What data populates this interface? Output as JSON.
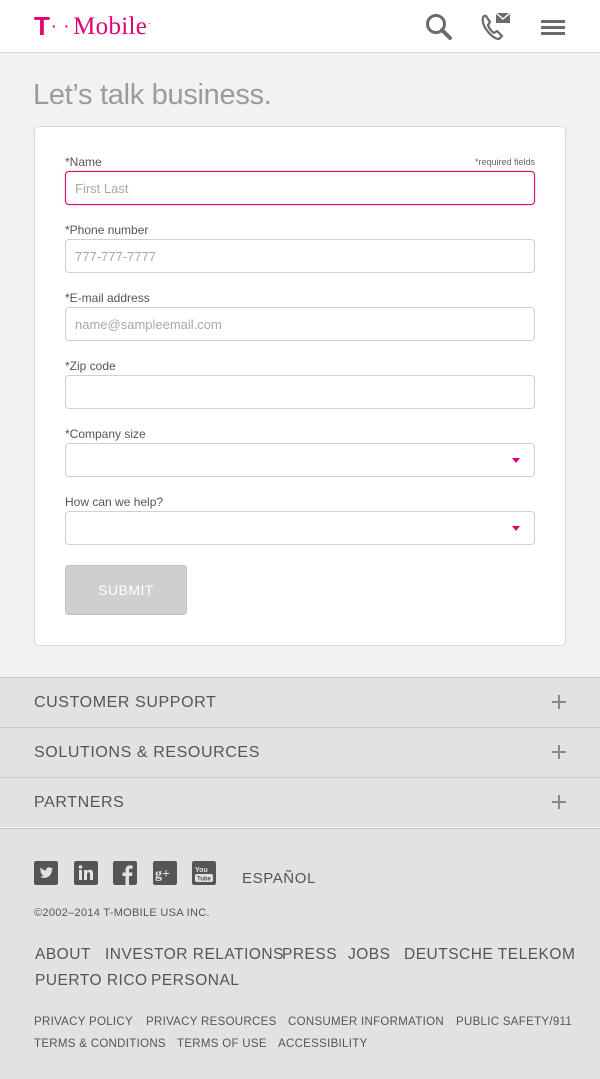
{
  "header": {
    "logo_t": "T",
    "logo_dots": "· ·",
    "logo_word": "Mobile",
    "logo_reg": "·"
  },
  "page": {
    "title": "Let’s talk business."
  },
  "form": {
    "required_note": "*required fields",
    "name_label": "*Name",
    "name_placeholder": "First Last",
    "phone_label": "*Phone number",
    "phone_placeholder": "777-777-7777",
    "email_label": "*E-mail address",
    "email_placeholder": "name@sampleemail.com",
    "zip_label": "*Zip code",
    "zip_value": "",
    "company_label": "*Company size",
    "company_value": "",
    "help_label": "How can we help?",
    "help_value": "",
    "submit_label": "SUBMIT"
  },
  "accordion": {
    "items": [
      {
        "label": "CUSTOMER SUPPORT"
      },
      {
        "label": "SOLUTIONS & RESOURCES"
      },
      {
        "label": "PARTNERS"
      }
    ]
  },
  "footer": {
    "social": [
      "twitter-icon",
      "linkedin-icon",
      "facebook-icon",
      "google-plus-icon",
      "youtube-icon"
    ],
    "espanol": "ESPAÑOL",
    "copyright": "©2002–2014 T-MOBILE USA INC.",
    "main_links": [
      "ABOUT",
      "INVESTOR RELATIONS",
      "PRESS",
      "JOBS",
      "DEUTSCHE TELEKOM",
      "PUERTO RICO",
      "PERSONAL"
    ],
    "small_links": [
      "PRIVACY POLICY",
      "PRIVACY RESOURCES",
      "CONSUMER INFORMATION",
      "PUBLIC SAFETY/911",
      "TERMS & CONDITIONS",
      "TERMS OF USE",
      "ACCESSIBILITY"
    ]
  },
  "colors": {
    "brand": "#e20074",
    "text": "#555555",
    "background": "#f3f2f2",
    "panel": "#e2e2e2"
  }
}
